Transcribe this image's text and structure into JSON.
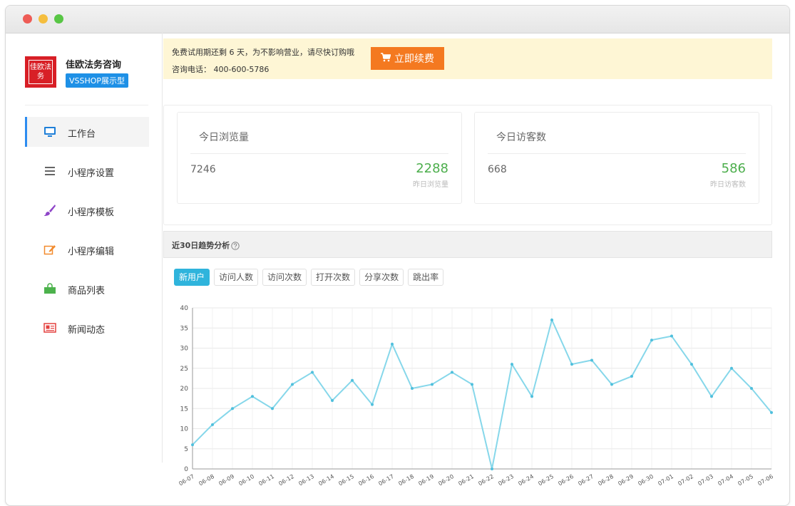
{
  "brand": {
    "logo_text": "佳欧法务",
    "name": "佳欧法务咨询",
    "badge": "VSSHOP展示型"
  },
  "sidebar": {
    "items": [
      {
        "label": "工作台",
        "icon": "monitor-icon",
        "active": true
      },
      {
        "label": "小程序设置",
        "icon": "list-icon",
        "active": false
      },
      {
        "label": "小程序模板",
        "icon": "brush-icon",
        "active": false
      },
      {
        "label": "小程序编辑",
        "icon": "edit-icon",
        "active": false
      },
      {
        "label": "商品列表",
        "icon": "shopping-bag-icon",
        "active": false
      },
      {
        "label": "新闻动态",
        "icon": "newspaper-icon",
        "active": false
      }
    ]
  },
  "notice": {
    "line1": "免费试用期还剩 6 天，为不影响营业，请尽快订购哦",
    "line2": "咨询电话： 400-600-5786",
    "button_label": "立即续费",
    "button_icon": "cart-icon"
  },
  "stats": [
    {
      "title": "今日浏览量",
      "value": "7246",
      "compare_value": "2288",
      "compare_label": "昨日浏览量"
    },
    {
      "title": "今日访客数",
      "value": "668",
      "compare_value": "586",
      "compare_label": "昨日访客数"
    }
  ],
  "trend": {
    "title": "近30日趋势分析",
    "tabs": [
      {
        "label": "新用户",
        "active": true
      },
      {
        "label": "访问人数",
        "active": false
      },
      {
        "label": "访问次数",
        "active": false
      },
      {
        "label": "打开次数",
        "active": false
      },
      {
        "label": "分享次数",
        "active": false
      },
      {
        "label": "跳出率",
        "active": false
      }
    ]
  },
  "colors": {
    "accent": "#2fb4dc",
    "line": "#86d7ea",
    "renew": "#f47920",
    "notice_bg": "#fef6d5",
    "positive": "#4cae4c"
  },
  "chart_data": {
    "type": "line",
    "x": [
      "06-07",
      "06-08",
      "06-09",
      "06-10",
      "06-11",
      "06-12",
      "06-13",
      "06-14",
      "06-15",
      "06-16",
      "06-17",
      "06-18",
      "06-19",
      "06-20",
      "06-21",
      "06-22",
      "06-23",
      "06-24",
      "06-25",
      "06-26",
      "06-27",
      "06-28",
      "06-29",
      "06-30",
      "07-01",
      "07-02",
      "07-03",
      "07-04",
      "07-05",
      "07-06"
    ],
    "series": [
      {
        "values": [
          6,
          11,
          15,
          18,
          15,
          21,
          24,
          17,
          22,
          16,
          31,
          20,
          21,
          24,
          21,
          0,
          26,
          18,
          37,
          26,
          27,
          21,
          23,
          32,
          33,
          26,
          18,
          25,
          20,
          14
        ]
      }
    ],
    "ylim": [
      0,
      40
    ],
    "yticks": [
      0,
      5,
      10,
      15,
      20,
      25,
      30,
      35,
      40
    ],
    "grid": true
  }
}
